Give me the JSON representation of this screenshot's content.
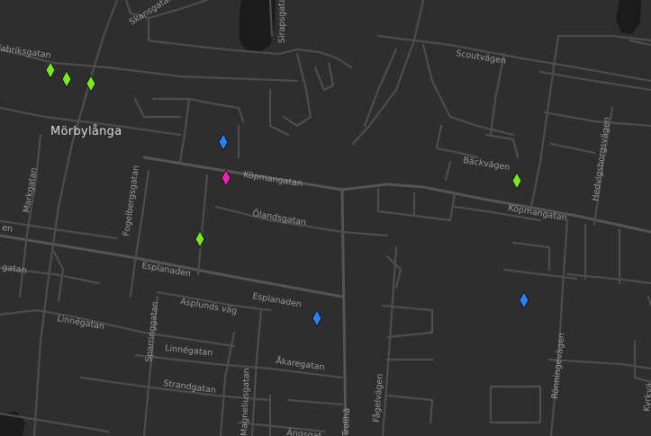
{
  "map": {
    "town_label": "Mörbylånga",
    "marker_colors": {
      "green": "#79e81f",
      "blue": "#2a82f6",
      "magenta": "#ee22b0"
    },
    "street_labels": {
      "skansgatan": "Skansgatan",
      "sirapsgatan": "Sirapsgatan",
      "scoutvagen": "Scoutvägen",
      "fabriksgatan": "Fabriksgatan",
      "hedvigsborgsvagen": "Hedvigsborgsvägen",
      "backvagen": "Bäckvägen",
      "kopmangatan_1": "Köpmangatan",
      "kopmangatan_2": "Köpmangatan",
      "markgatan": "Markgatan",
      "fogelbergsgatan": "Fogelbergsgatan",
      "olandsgatan": "Ölandsgatan",
      "esplanaden_1": "Esplanaden",
      "esplanaden_2": "Esplanaden",
      "aplunds_vag": "Asplunds väg",
      "sparringgatan": "Sparringgatan",
      "linnegatan_1": "Linnégatan",
      "linnegatan_2": "Linnégatan",
      "akaregatan": "Åkaregatan",
      "strandgatan": "Strandgatan",
      "fagelvagen": "Fågelvägen",
      "ronningevagen": "Rönningevägen",
      "trollhattegatan": "Trollhä",
      "magnelius": "Magneliusgatan",
      "angsgatan": "Ängsgat",
      "kyrkvagen": "Kyrkvä",
      "edge_left_1": "en",
      "edge_left_2": "gatan"
    }
  }
}
